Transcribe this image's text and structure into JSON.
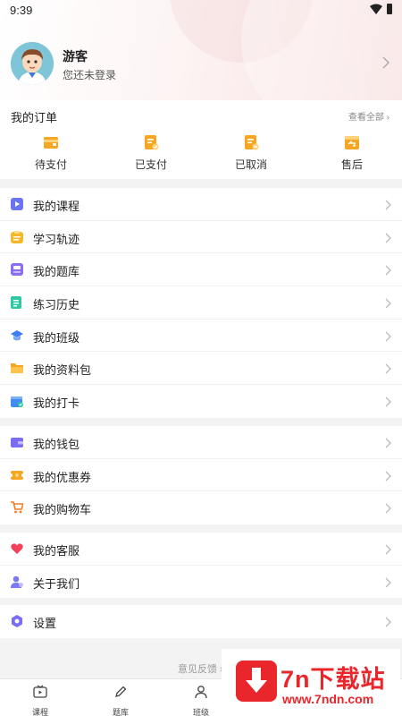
{
  "status_bar": {
    "time": "9:39"
  },
  "profile": {
    "name": "游客",
    "subtitle": "您还未登录"
  },
  "orders": {
    "title": "我的订单",
    "view_all": "查看全部 ›",
    "items": [
      {
        "label": "待支付",
        "icon": "wallet-pending-icon"
      },
      {
        "label": "已支付",
        "icon": "paid-receipt-icon"
      },
      {
        "label": "已取消",
        "icon": "cancelled-order-icon"
      },
      {
        "label": "售后",
        "icon": "after-sales-icon"
      }
    ]
  },
  "menu_groups": [
    [
      {
        "label": "我的课程",
        "icon": "course-icon",
        "color": "#6b74f2"
      },
      {
        "label": "学习轨迹",
        "icon": "study-track-icon",
        "color": "#f5b82a"
      },
      {
        "label": "我的题库",
        "icon": "question-bank-icon",
        "color": "#8a6df2"
      },
      {
        "label": "练习历史",
        "icon": "practice-history-icon",
        "color": "#2fc9a3"
      },
      {
        "label": "我的班级",
        "icon": "class-cap-icon",
        "color": "#3f7df2"
      },
      {
        "label": "我的资料包",
        "icon": "folder-icon",
        "color": "#f5a623"
      },
      {
        "label": "我的打卡",
        "icon": "calendar-check-icon",
        "color": "#3f8df2"
      }
    ],
    [
      {
        "label": "我的钱包",
        "icon": "wallet-icon",
        "color": "#7a6df2"
      },
      {
        "label": "我的优惠券",
        "icon": "coupon-icon",
        "color": "#f5a623"
      },
      {
        "label": "我的购物车",
        "icon": "cart-icon",
        "color": "#f57a23"
      }
    ],
    [
      {
        "label": "我的客服",
        "icon": "heart-service-icon",
        "color": "#f0405a"
      },
      {
        "label": "关于我们",
        "icon": "about-us-icon",
        "color": "#7a7af2"
      }
    ],
    [
      {
        "label": "设置",
        "icon": "settings-icon",
        "color": "#7a6df2"
      }
    ]
  ],
  "feedback": "意见反馈 ›",
  "tabs": [
    {
      "label": "课程",
      "icon": "course-tab-icon"
    },
    {
      "label": "题库",
      "icon": "question-bank-tab-icon"
    },
    {
      "label": "班级",
      "icon": "class-tab-icon"
    }
  ],
  "watermark": {
    "title": "7n下载站",
    "url": "www.7ndn.com"
  },
  "colors": {
    "accent": "#e8262b",
    "order_icon": "#f5a623"
  }
}
